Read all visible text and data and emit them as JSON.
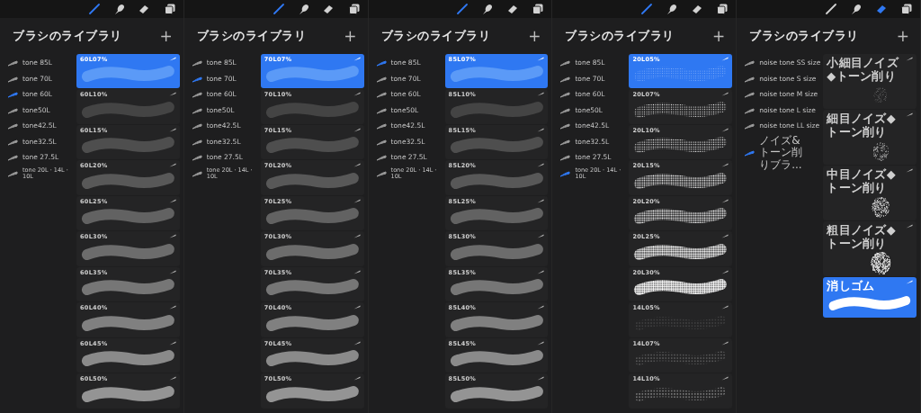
{
  "panels": [
    {
      "tools": [
        {
          "kind": "brush",
          "selected": true
        },
        {
          "kind": "smudge",
          "selected": false
        },
        {
          "kind": "eraser",
          "selected": false
        },
        {
          "kind": "layers",
          "selected": false
        }
      ],
      "title": "ブラシのライブラリ",
      "add": "+",
      "sets": [
        {
          "label": "tone 85L",
          "selected": false
        },
        {
          "label": "tone 70L",
          "selected": false
        },
        {
          "label": "tone 60L",
          "selected": true
        },
        {
          "label": "tone50L",
          "selected": false
        },
        {
          "label": "tone42.5L",
          "selected": false
        },
        {
          "label": "tone32.5L",
          "selected": false
        },
        {
          "label": "tone 27.5L",
          "selected": false
        },
        {
          "label": "tone 20L · 14L · 10L",
          "selected": false,
          "kind": "small"
        }
      ],
      "brushes": [
        {
          "label": "60L07%",
          "kind": "tone",
          "selected": true
        },
        {
          "label": "60L10%",
          "kind": "tone",
          "selected": false
        },
        {
          "label": "60L15%",
          "kind": "tone",
          "selected": false
        },
        {
          "label": "60L20%",
          "kind": "tone",
          "selected": false
        },
        {
          "label": "60L25%",
          "kind": "tone",
          "selected": false
        },
        {
          "label": "60L30%",
          "kind": "tone",
          "selected": false
        },
        {
          "label": "60L35%",
          "kind": "tone",
          "selected": false
        },
        {
          "label": "60L40%",
          "kind": "tone",
          "selected": false
        },
        {
          "label": "60L45%",
          "kind": "tone",
          "selected": false
        },
        {
          "label": "60L50%",
          "kind": "tone",
          "selected": false
        }
      ]
    },
    {
      "tools": [
        {
          "kind": "brush",
          "selected": true
        },
        {
          "kind": "smudge",
          "selected": false
        },
        {
          "kind": "eraser",
          "selected": false
        },
        {
          "kind": "layers",
          "selected": false
        }
      ],
      "title": "ブラシのライブラリ",
      "add": "+",
      "sets": [
        {
          "label": "tone 85L",
          "selected": false
        },
        {
          "label": "tone 70L",
          "selected": true
        },
        {
          "label": "tone 60L",
          "selected": false
        },
        {
          "label": "tone50L",
          "selected": false
        },
        {
          "label": "tone42.5L",
          "selected": false
        },
        {
          "label": "tone32.5L",
          "selected": false
        },
        {
          "label": "tone 27.5L",
          "selected": false
        },
        {
          "label": "tone 20L · 14L · 10L",
          "selected": false,
          "kind": "small"
        }
      ],
      "brushes": [
        {
          "label": "70L07%",
          "kind": "tone",
          "selected": true
        },
        {
          "label": "70L10%",
          "kind": "tone",
          "selected": false
        },
        {
          "label": "70L15%",
          "kind": "tone",
          "selected": false
        },
        {
          "label": "70L20%",
          "kind": "tone",
          "selected": false
        },
        {
          "label": "70L25%",
          "kind": "tone",
          "selected": false
        },
        {
          "label": "70L30%",
          "kind": "tone",
          "selected": false
        },
        {
          "label": "70L35%",
          "kind": "tone",
          "selected": false
        },
        {
          "label": "70L40%",
          "kind": "tone",
          "selected": false
        },
        {
          "label": "70L45%",
          "kind": "tone",
          "selected": false
        },
        {
          "label": "70L50%",
          "kind": "tone",
          "selected": false
        }
      ]
    },
    {
      "tools": [
        {
          "kind": "brush",
          "selected": true
        },
        {
          "kind": "smudge",
          "selected": false
        },
        {
          "kind": "eraser",
          "selected": false
        },
        {
          "kind": "layers",
          "selected": false
        }
      ],
      "title": "ブラシのライブラリ",
      "add": "+",
      "sets": [
        {
          "label": "tone 85L",
          "selected": true
        },
        {
          "label": "tone 70L",
          "selected": false
        },
        {
          "label": "tone 60L",
          "selected": false
        },
        {
          "label": "tone50L",
          "selected": false
        },
        {
          "label": "tone42.5L",
          "selected": false
        },
        {
          "label": "tone32.5L",
          "selected": false
        },
        {
          "label": "tone 27.5L",
          "selected": false
        },
        {
          "label": "tone 20L · 14L · 10L",
          "selected": false,
          "kind": "small"
        }
      ],
      "brushes": [
        {
          "label": "85L07%",
          "kind": "tone",
          "selected": true
        },
        {
          "label": "85L10%",
          "kind": "tone",
          "selected": false
        },
        {
          "label": "85L15%",
          "kind": "tone",
          "selected": false
        },
        {
          "label": "85L20%",
          "kind": "tone",
          "selected": false
        },
        {
          "label": "85L25%",
          "kind": "tone",
          "selected": false
        },
        {
          "label": "85L30%",
          "kind": "tone",
          "selected": false
        },
        {
          "label": "85L35%",
          "kind": "tone",
          "selected": false
        },
        {
          "label": "85L40%",
          "kind": "tone",
          "selected": false
        },
        {
          "label": "85L45%",
          "kind": "tone",
          "selected": false
        },
        {
          "label": "85L50%",
          "kind": "tone",
          "selected": false
        }
      ]
    },
    {
      "tools": [
        {
          "kind": "brush",
          "selected": true
        },
        {
          "kind": "smudge",
          "selected": false
        },
        {
          "kind": "eraser",
          "selected": false
        },
        {
          "kind": "layers",
          "selected": false
        }
      ],
      "title": "ブラシのライブラリ",
      "add": "+",
      "sets": [
        {
          "label": "tone 85L",
          "selected": false
        },
        {
          "label": "tone 70L",
          "selected": false
        },
        {
          "label": "tone 60L",
          "selected": false
        },
        {
          "label": "tone50L",
          "selected": false
        },
        {
          "label": "tone42.5L",
          "selected": false
        },
        {
          "label": "tone32.5L",
          "selected": false
        },
        {
          "label": "tone 27.5L",
          "selected": false
        },
        {
          "label": "tone 20L · 14L · 10L",
          "selected": true,
          "kind": "small"
        }
      ],
      "brushes": [
        {
          "label": "20L05%",
          "kind": "dots",
          "selected": true
        },
        {
          "label": "20L07%",
          "kind": "dots",
          "selected": false
        },
        {
          "label": "20L10%",
          "kind": "dots",
          "selected": false
        },
        {
          "label": "20L15%",
          "kind": "dots",
          "selected": false
        },
        {
          "label": "20L20%",
          "kind": "dots",
          "selected": false
        },
        {
          "label": "20L25%",
          "kind": "dots",
          "selected": false
        },
        {
          "label": "20L30%",
          "kind": "dots",
          "selected": false
        },
        {
          "label": "14L05%",
          "kind": "sparse",
          "selected": false
        },
        {
          "label": "14L07%",
          "kind": "sparse",
          "selected": false
        },
        {
          "label": "14L10%",
          "kind": "sparse",
          "selected": false
        }
      ]
    },
    {
      "tools": [
        {
          "kind": "brush",
          "selected": false
        },
        {
          "kind": "smudge",
          "selected": false
        },
        {
          "kind": "eraser",
          "selected": true
        },
        {
          "kind": "layers",
          "selected": false
        }
      ],
      "title": "ブラシのライブラリ",
      "add": "+",
      "sets": [
        {
          "label": "noise tone SS size",
          "selected": false
        },
        {
          "label": "noise tone S size",
          "selected": false
        },
        {
          "label": "noise tone M size",
          "selected": false
        },
        {
          "label": "noise tone L size",
          "selected": false
        },
        {
          "label": "noise tone LL size",
          "selected": false
        },
        {
          "label": "ノイズ&トーン削りブラ...",
          "selected": true,
          "kind": "small"
        }
      ],
      "brushes": [
        {
          "label": "小細目ノイズ◆トーン削り",
          "kind": "noise",
          "selected": false
        },
        {
          "label": "細目ノイズ◆トーン削り",
          "kind": "noise",
          "selected": false
        },
        {
          "label": "中目ノイズ◆トーン削り",
          "kind": "noise",
          "selected": false
        },
        {
          "label": "粗目ノイズ◆トーン削り",
          "kind": "noise",
          "selected": false
        },
        {
          "label": "消しゴム",
          "kind": "eraser",
          "selected": true
        }
      ]
    }
  ]
}
